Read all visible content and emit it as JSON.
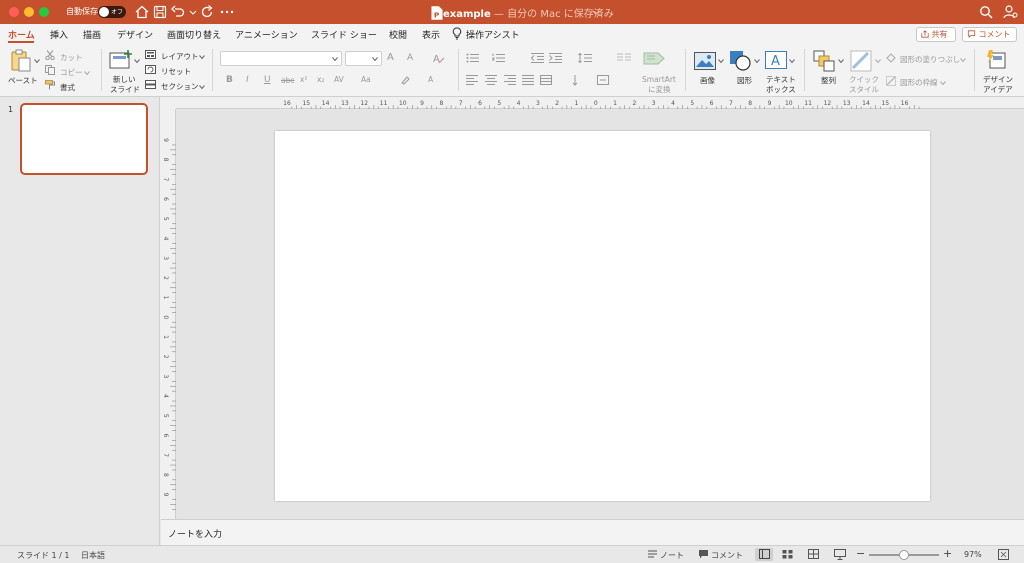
{
  "titlebar": {
    "autosave_label": "自動保存",
    "autosave_state": "オフ",
    "doc_name": "example",
    "doc_status": " — 自分の Mac に保存済み",
    "accent": "#c4502d"
  },
  "menu": {
    "tabs": [
      {
        "label": "ホーム",
        "active": true
      },
      {
        "label": "挿入"
      },
      {
        "label": "描画"
      },
      {
        "label": "デザイン"
      },
      {
        "label": "画面切り替え"
      },
      {
        "label": "アニメーション"
      },
      {
        "label": "スライド ショー"
      },
      {
        "label": "校閲"
      },
      {
        "label": "表示"
      },
      {
        "label": "操作アシスト"
      }
    ],
    "share_label": "共有",
    "comment_label": "コメント"
  },
  "ribbon": {
    "paste": "ペースト",
    "cut": "カット",
    "copy": "コピー",
    "format": "書式",
    "new_slide_line1": "新しい",
    "new_slide_line2": "スライド",
    "layout": "レイアウト",
    "reset": "リセット",
    "section": "セクション",
    "bold": "B",
    "italic": "I",
    "underline": "U",
    "strike": "abc",
    "superscript": "x²",
    "subscript": "x₂",
    "char_spacing": "AV",
    "change_case": "Aa",
    "font_color": "A",
    "grow_font": "A",
    "shrink_font": "A",
    "smartart_line1": "SmartArt",
    "smartart_line2": "に変換",
    "picture": "画像",
    "shapes": "図形",
    "textbox_line1": "テキスト",
    "textbox_line2": "ボックス",
    "arrange": "整列",
    "quick_style_line1": "クイック",
    "quick_style_line2": "スタイル",
    "shape_fill": "図形の塗りつぶし",
    "shape_outline": "図形の枠線",
    "design_ideas_line1": "デザイン",
    "design_ideas_line2": "アイデア"
  },
  "panel": {
    "slide_number": "1"
  },
  "ruler": {
    "h_ticks": [
      "16",
      "15",
      "14",
      "13",
      "12",
      "11",
      "10",
      "9",
      "8",
      "7",
      "6",
      "5",
      "4",
      "3",
      "2",
      "1",
      "0",
      "1",
      "2",
      "3",
      "4",
      "5",
      "6",
      "7",
      "8",
      "9",
      "10",
      "11",
      "12",
      "13",
      "14",
      "15",
      "16"
    ],
    "v_ticks": [
      "9",
      "8",
      "7",
      "6",
      "5",
      "4",
      "3",
      "2",
      "1",
      "0",
      "1",
      "2",
      "3",
      "4",
      "5",
      "6",
      "7",
      "8",
      "9"
    ]
  },
  "notes": {
    "placeholder": "ノートを入力"
  },
  "status": {
    "slide_counter": "スライド 1 / 1",
    "language": "日本語",
    "notes_label": "ノート",
    "comments_label": "コメント",
    "zoom": "97%",
    "zoom_level": 0.5
  }
}
